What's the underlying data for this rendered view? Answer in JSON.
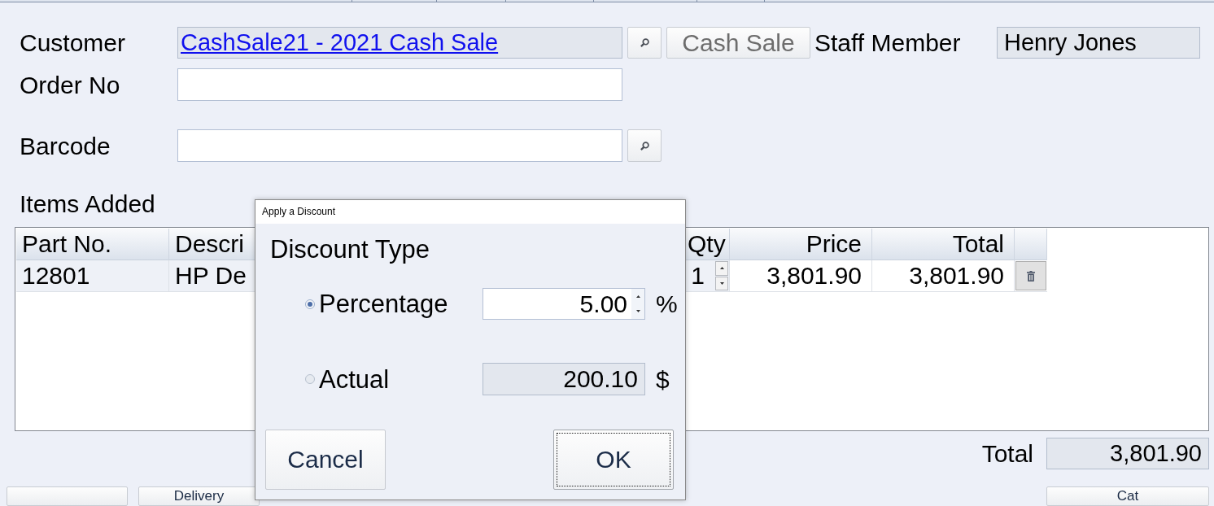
{
  "customer": {
    "label": "Customer",
    "value": "CashSale21 - 2021 Cash Sale",
    "readonly": true
  },
  "cash_sale_button": {
    "label": "Cash Sale",
    "disabled": true
  },
  "staff_member": {
    "label": "Staff Member",
    "value": "Henry Jones",
    "readonly": true
  },
  "order_no": {
    "label": "Order No",
    "readonly": false
  },
  "barcode": {
    "label": "Barcode",
    "readonly": false
  },
  "items": {
    "title": "Items Added",
    "columns": [
      {
        "label": "Part No.",
        "kind": "text"
      },
      {
        "label": "Descri",
        "kind": "text"
      },
      {
        "label": "Qty",
        "kind": "qty"
      },
      {
        "label": "Price",
        "kind": "number"
      },
      {
        "label": "Total",
        "kind": "number"
      },
      {
        "kind": "action"
      }
    ],
    "rows": [
      {
        "cells": [
          "12801",
          "HP De",
          "1",
          "3,801.90",
          "3,801.90"
        ]
      }
    ]
  },
  "total": {
    "label": "Total",
    "value": "3,801.90"
  },
  "bottom_buttons": {
    "left": [
      {
        "kind": "blank"
      },
      {
        "kind": "labeled",
        "label": "Delivery"
      }
    ],
    "right": [
      {
        "kind": "labeled",
        "label": "Cat"
      }
    ]
  },
  "dialog": {
    "title": "Apply a Discount",
    "heading": "Discount Type",
    "options": [
      {
        "label": "Percentage",
        "selected": true,
        "kind": "spinner",
        "value": "5.00",
        "unit": "%"
      },
      {
        "label": "Actual",
        "selected": false,
        "kind": "text",
        "value": "200.10",
        "unit": "$"
      }
    ],
    "buttons": [
      {
        "label": "Cancel",
        "focused": false
      },
      {
        "label": "OK",
        "focused": true
      }
    ]
  }
}
